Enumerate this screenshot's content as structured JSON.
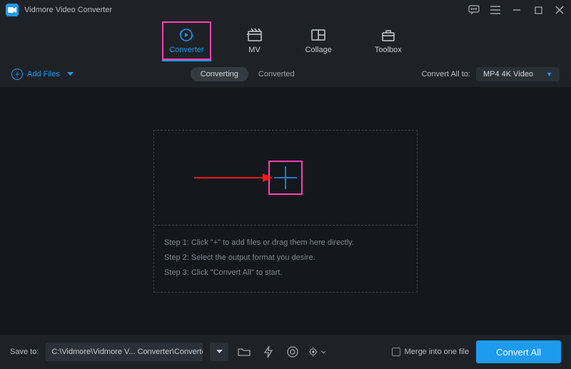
{
  "app": {
    "title": "Vidmore Video Converter"
  },
  "nav": {
    "items": [
      {
        "label": "Converter"
      },
      {
        "label": "MV"
      },
      {
        "label": "Collage"
      },
      {
        "label": "Toolbox"
      }
    ]
  },
  "secondary": {
    "add_files_label": "Add Files",
    "tab_converting": "Converting",
    "tab_converted": "Converted",
    "convert_all_to_label": "Convert All to:",
    "format_selected": "MP4 4K Video"
  },
  "dropzone": {
    "step1": "Step 1: Click \"+\" to add files or drag them here directly.",
    "step2": "Step 2: Select the output format you desire.",
    "step3": "Step 3: Click \"Convert All\" to start."
  },
  "footer": {
    "save_to_label": "Save to:",
    "path": "C:\\Vidmore\\Vidmore V... Converter\\Converted",
    "merge_label": "Merge into one file",
    "convert_btn": "Convert All"
  }
}
